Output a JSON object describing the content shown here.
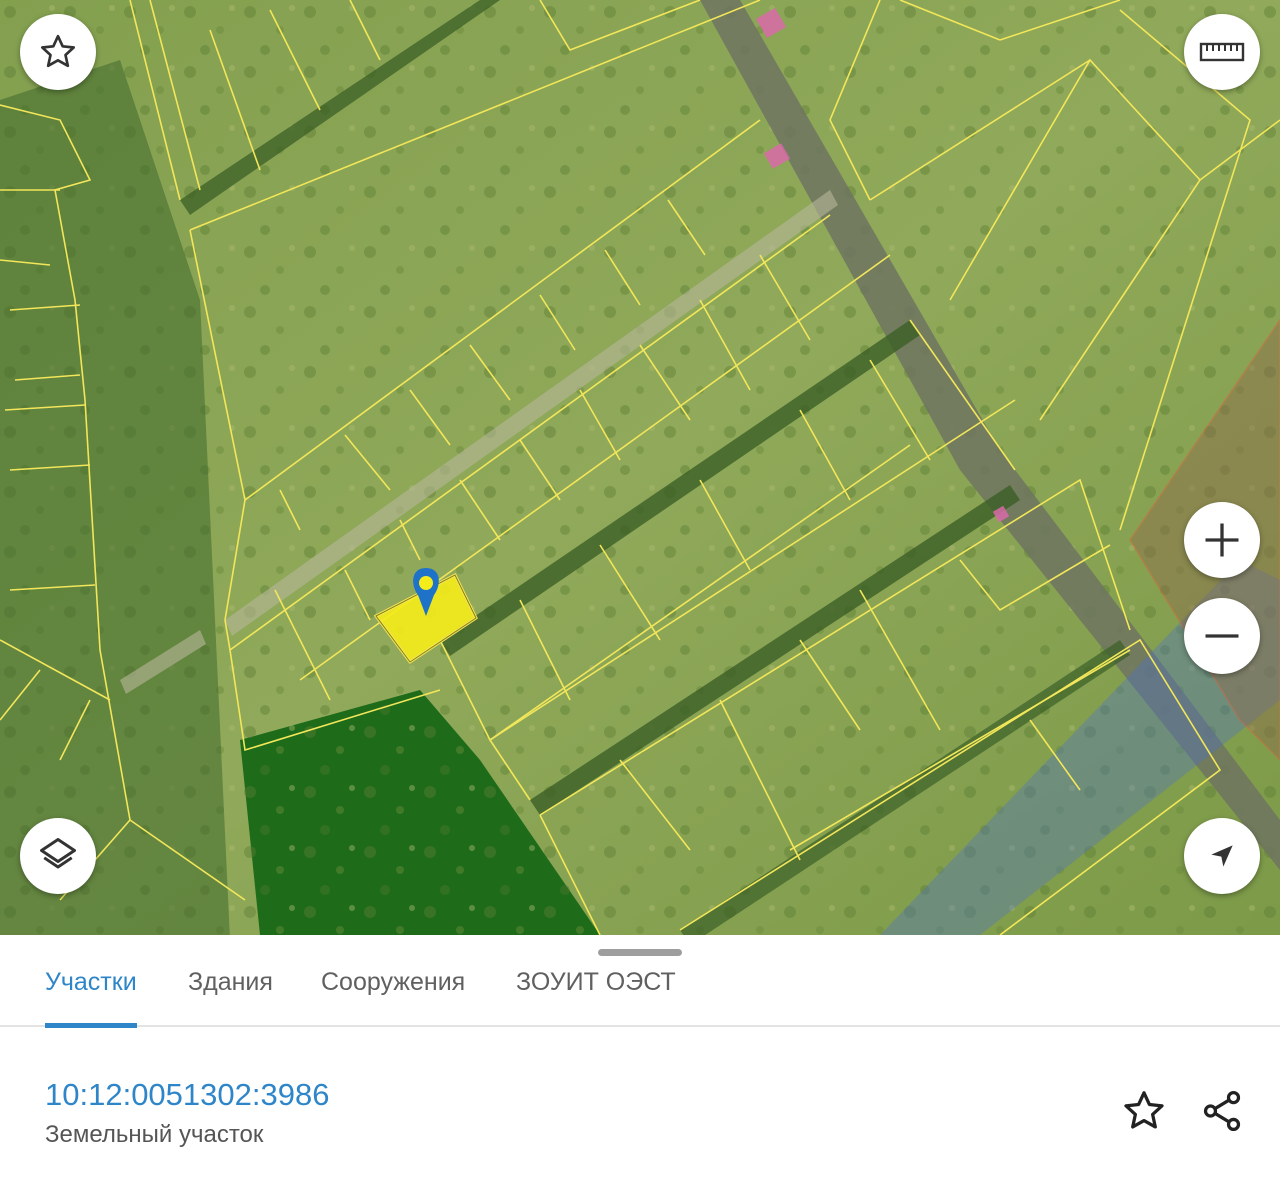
{
  "tabs": [
    {
      "label": "Участки",
      "active": true
    },
    {
      "label": "Здания",
      "active": false
    },
    {
      "label": "Сооружения",
      "active": false
    },
    {
      "label": "ЗОУИТ ОЭСТ",
      "active": false
    }
  ],
  "parcel": {
    "cadastral_number": "10:12:0051302:3986",
    "type": "Земельный участок"
  },
  "map_controls": {
    "favorite": "star-icon",
    "ruler": "ruler-icon",
    "layers": "layers-icon",
    "zoom_in": "plus-icon",
    "zoom_out": "minus-icon",
    "locate": "navigation-arrow-icon"
  },
  "actions": {
    "favorite": "star-outline-icon",
    "share": "share-icon"
  },
  "colors": {
    "accent": "#2e86c9",
    "parcel_outline": "#f2e65a",
    "selected_parcel_fill": "#f5ec1a",
    "forest_zone": "#2fae2f",
    "water_zone": "#4a6fd0"
  }
}
